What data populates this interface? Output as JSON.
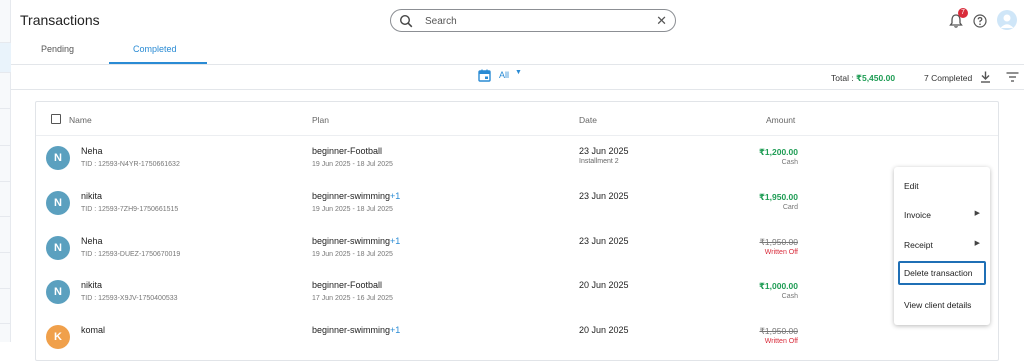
{
  "header": {
    "title": "Transactions",
    "search_placeholder": "Search",
    "notification_count": "7"
  },
  "tabs": [
    {
      "label": "Pending",
      "active": false
    },
    {
      "label": "Completed",
      "active": true
    }
  ],
  "filters": {
    "date_filter": "All",
    "total_label": "Total : ",
    "total_value": "₹5,450.00",
    "completed_count": "7 Completed"
  },
  "table": {
    "columns": [
      "Name",
      "Plan",
      "Date",
      "Amount"
    ],
    "rows": [
      {
        "initial": "N",
        "avatar_color": "#5ba0bf",
        "name": "Neha",
        "tid": "TID : 12593-N4YR-1750661632",
        "plan": "beginner-Football",
        "plan_extra": "",
        "range": "19 Jun 2025 - 18 Jul 2025",
        "date": "23 Jun 2025",
        "date_note": "Installment 2",
        "amount": "₹1,200.00",
        "amount_status": "Cash",
        "style": "paid"
      },
      {
        "initial": "N",
        "avatar_color": "#5ba0bf",
        "name": "nikita",
        "tid": "TID : 12593-7ZH9-1750661515",
        "plan": "beginner-swimming",
        "plan_extra": "+1",
        "range": "19 Jun 2025 - 18 Jul 2025",
        "date": "23 Jun 2025",
        "date_note": "",
        "amount": "₹1,950.00",
        "amount_status": "Card",
        "style": "paid"
      },
      {
        "initial": "N",
        "avatar_color": "#5ba0bf",
        "name": "Neha",
        "tid": "TID : 12593-DUEZ-1750670019",
        "plan": "beginner-swimming",
        "plan_extra": "+1",
        "range": "19 Jun 2025 - 18 Jul 2025",
        "date": "23 Jun 2025",
        "date_note": "",
        "amount": "₹1,950.00",
        "amount_status": "Written Off",
        "style": "writtenoff"
      },
      {
        "initial": "N",
        "avatar_color": "#5ba0bf",
        "name": "nikita",
        "tid": "TID : 12593-X9JV-1750400533",
        "plan": "beginner-Football",
        "plan_extra": "",
        "range": "17 Jun 2025 - 16 Jul 2025",
        "date": "20 Jun 2025",
        "date_note": "",
        "amount": "₹1,000.00",
        "amount_status": "Cash",
        "style": "paid"
      },
      {
        "initial": "K",
        "avatar_color": "#f0a04b",
        "name": "komal",
        "tid": "",
        "plan": "beginner-swimming",
        "plan_extra": "+1",
        "range": "",
        "date": "20 Jun 2025",
        "date_note": "",
        "amount": "₹1,950.00",
        "amount_status": "Written Off",
        "style": "writtenoff"
      }
    ]
  },
  "context_menu": {
    "items": [
      {
        "label": "Edit",
        "submenu": false,
        "highlighted": false
      },
      {
        "label": "Invoice",
        "submenu": true,
        "highlighted": false
      },
      {
        "label": "Receipt",
        "submenu": true,
        "highlighted": false
      },
      {
        "label": "Delete transaction",
        "submenu": false,
        "highlighted": true
      },
      {
        "label": "View client details",
        "submenu": false,
        "highlighted": false
      }
    ]
  },
  "colors": {
    "accent": "#2a8bd4",
    "paid_green": "#1f9d55",
    "written_off_red": "#d92b3a"
  }
}
